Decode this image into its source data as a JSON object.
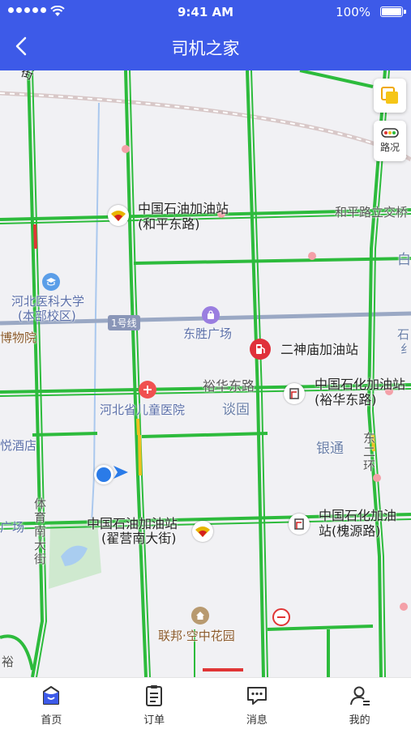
{
  "status_bar": {
    "time": "9:41 AM",
    "battery": "100%"
  },
  "navbar": {
    "title": "司机之家"
  },
  "map_controls": {
    "traffic_label": "路况"
  },
  "map_labels": {
    "jie": "街",
    "zhongshiyou_hp_1": "中国石油加油站",
    "zhongshiyou_hp_2": "(和平东路)",
    "hepinglu": "和平路立交桥",
    "bai": "白",
    "hebei_med_1": "河北医科大学",
    "hebei_med_2": "(本部校区)",
    "museum": "博物院",
    "line1": "1号线",
    "dongsheng": "东胜广场",
    "shi": "石",
    "jing": "纟",
    "ershenmiao": "二神庙加油站",
    "yuhua": "裕华东路",
    "zhongshihua_yh_1": "中国石化加油站",
    "zhongshihua_yh_2": "(裕华东路)",
    "children_hospital": "河北省儿童医院",
    "tangu": "谈固",
    "yintong": "银通",
    "dongerhuan": "东二环",
    "yue_hotel": "悦酒店",
    "tiyu": "体育南大街",
    "guang": "广场",
    "zhongshiyou_zy_1": "中国石油加油站",
    "zhongshiyou_zy_2": "(翟营南大街)",
    "zhongshihua_hy_1": "中国石化加油",
    "zhongshihua_hy_2": "站(槐源路)",
    "lianbang": "联邦·空中花园",
    "yu": "裕"
  },
  "tabbar": {
    "home": "首页",
    "orders": "订单",
    "messages": "消息",
    "mine": "我的"
  },
  "colors": {
    "brand": "#3d5ae8",
    "road": "#2dbb3c",
    "jam": "#e03535"
  }
}
